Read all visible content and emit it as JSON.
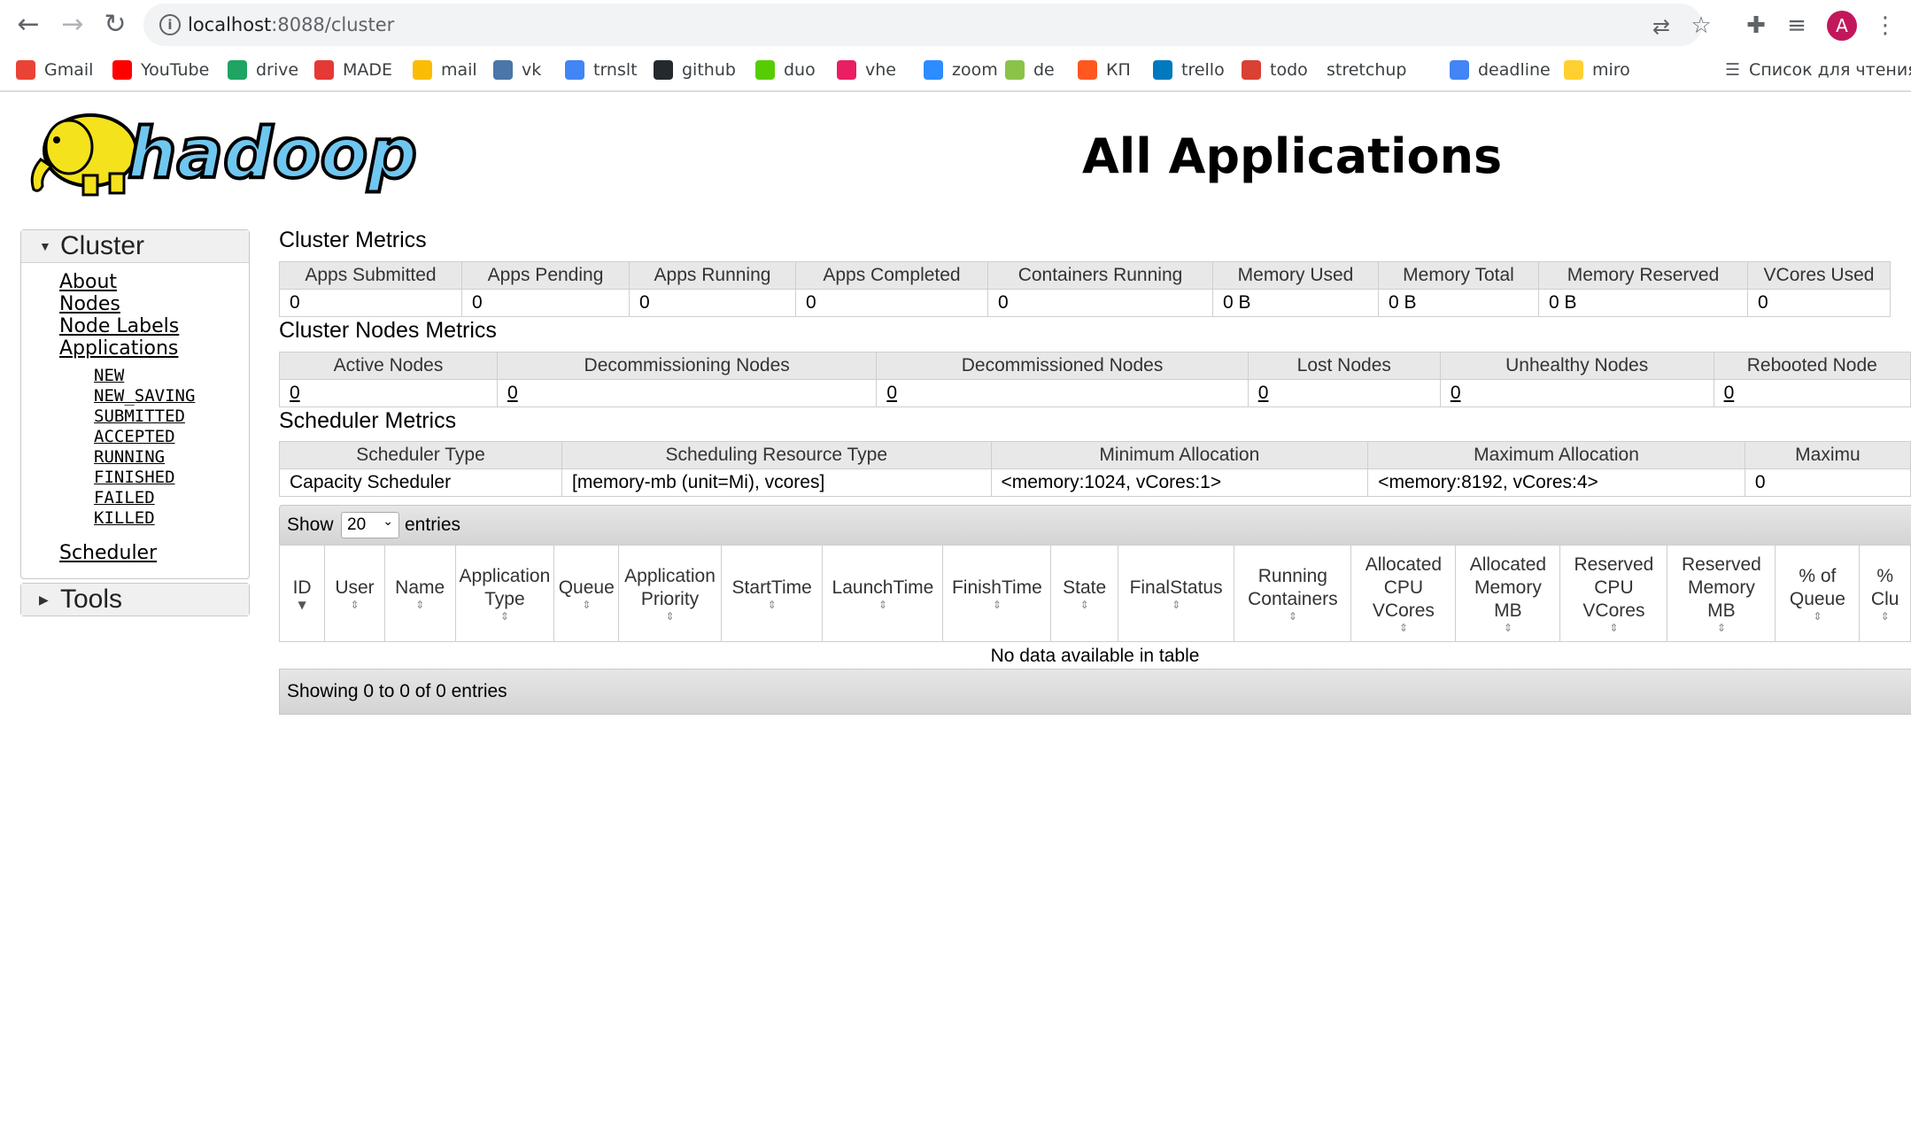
{
  "browser": {
    "url_host": "localhost",
    "url_path": ":8088/cluster",
    "avatar_letter": "A",
    "bookmarks": [
      {
        "label": "Gmail",
        "icon": "gmail-icon",
        "color": "#ea4335"
      },
      {
        "label": "YouTube",
        "icon": "youtube-icon",
        "color": "#ff0000"
      },
      {
        "label": "drive",
        "icon": "drive-icon",
        "color": "#1fa463"
      },
      {
        "label": "MADE",
        "icon": "made-icon",
        "color": "#e53935"
      },
      {
        "label": "mail",
        "icon": "mail-icon",
        "color": "#fbbc05"
      },
      {
        "label": "vk",
        "icon": "vk-icon",
        "color": "#4a76a8"
      },
      {
        "label": "trnslt",
        "icon": "translate-icon",
        "color": "#4285f4"
      },
      {
        "label": "github",
        "icon": "github-icon",
        "color": "#24292e"
      },
      {
        "label": "duo",
        "icon": "duolingo-icon",
        "color": "#58cc02"
      },
      {
        "label": "vhe",
        "icon": "vhe-icon",
        "color": "#e91e63"
      },
      {
        "label": "zoom",
        "icon": "zoom-icon",
        "color": "#2d8cff"
      },
      {
        "label": "de",
        "icon": "de-icon",
        "color": "#8bc34a"
      },
      {
        "label": "КП",
        "icon": "kp-icon",
        "color": "#ff5722"
      },
      {
        "label": "trello",
        "icon": "trello-icon",
        "color": "#0079bf"
      },
      {
        "label": "todo",
        "icon": "todoist-icon",
        "color": "#db4035"
      },
      {
        "label": "stretchup",
        "icon": "",
        "color": ""
      },
      {
        "label": "deadline",
        "icon": "docs-icon",
        "color": "#4285f4"
      },
      {
        "label": "miro",
        "icon": "miro-icon",
        "color": "#ffd02f"
      }
    ],
    "reading_list": "Список для чтения"
  },
  "page": {
    "logo_text": "hadoop",
    "title": "All Applications"
  },
  "sidebar": {
    "cluster": {
      "heading": "Cluster",
      "links": [
        "About",
        "Nodes",
        "Node Labels",
        "Applications"
      ],
      "app_states": [
        "NEW",
        "NEW_SAVING",
        "SUBMITTED",
        "ACCEPTED",
        "RUNNING",
        "FINISHED",
        "FAILED",
        "KILLED"
      ],
      "scheduler": "Scheduler"
    },
    "tools": {
      "heading": "Tools"
    }
  },
  "cluster_metrics": {
    "title": "Cluster Metrics",
    "headers": [
      "Apps Submitted",
      "Apps Pending",
      "Apps Running",
      "Apps Completed",
      "Containers Running",
      "Memory Used",
      "Memory Total",
      "Memory Reserved",
      "VCores Used"
    ],
    "values": [
      "0",
      "0",
      "0",
      "0",
      "0",
      "0 B",
      "0 B",
      "0 B",
      "0"
    ]
  },
  "nodes_metrics": {
    "title": "Cluster Nodes Metrics",
    "headers": [
      "Active Nodes",
      "Decommissioning Nodes",
      "Decommissioned Nodes",
      "Lost Nodes",
      "Unhealthy Nodes",
      "Rebooted Node"
    ],
    "values": [
      "0",
      "0",
      "0",
      "0",
      "0",
      "0"
    ]
  },
  "scheduler_metrics": {
    "title": "Scheduler Metrics",
    "headers": [
      "Scheduler Type",
      "Scheduling Resource Type",
      "Minimum Allocation",
      "Maximum Allocation",
      "Maximu"
    ],
    "values": [
      "Capacity Scheduler",
      "[memory-mb (unit=Mi), vcores]",
      "<memory:1024, vCores:1>",
      "<memory:8192, vCores:4>",
      "0"
    ]
  },
  "apps_table": {
    "show_label": "Show",
    "entries_label": "entries",
    "page_size": "20",
    "columns": [
      [
        "ID"
      ],
      [
        "User"
      ],
      [
        "Name"
      ],
      [
        "Application",
        "Type"
      ],
      [
        "Queue"
      ],
      [
        "Application",
        "Priority"
      ],
      [
        "StartTime"
      ],
      [
        "LaunchTime"
      ],
      [
        "FinishTime"
      ],
      [
        "State"
      ],
      [
        "FinalStatus"
      ],
      [
        "Running",
        "Containers"
      ],
      [
        "Allocated",
        "CPU",
        "VCores"
      ],
      [
        "Allocated",
        "Memory",
        "MB"
      ],
      [
        "Reserved",
        "CPU",
        "VCores"
      ],
      [
        "Reserved",
        "Memory",
        "MB"
      ],
      [
        "% of",
        "Queue"
      ],
      [
        "%",
        "Clu"
      ]
    ],
    "empty_message": "No data available in table",
    "info": "Showing 0 to 0 of 0 entries"
  }
}
